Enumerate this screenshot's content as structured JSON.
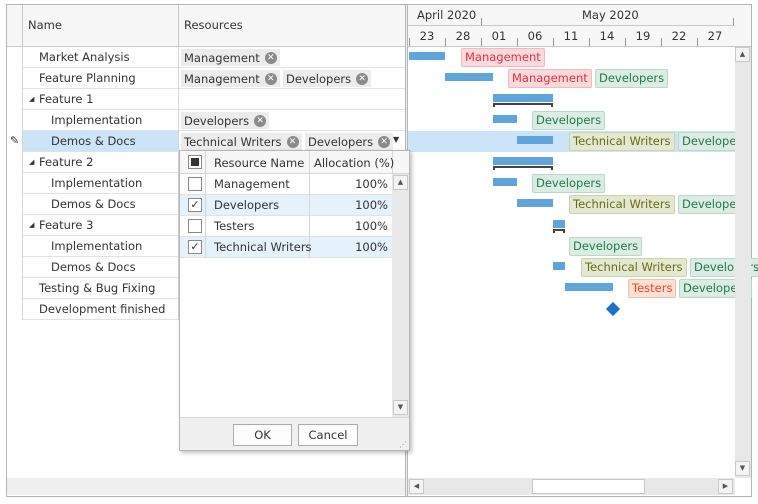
{
  "grid": {
    "columns": {
      "name": "Name",
      "resources": "Resources"
    },
    "rows": [
      {
        "name": "Market Analysis",
        "level": 0,
        "resources": [
          "Management"
        ]
      },
      {
        "name": "Feature Planning",
        "level": 0,
        "resources": [
          "Management",
          "Developers"
        ]
      },
      {
        "name": "Feature 1",
        "level": 0,
        "group": true,
        "resources": []
      },
      {
        "name": "Implementation",
        "level": 1,
        "resources": [
          "Developers"
        ]
      },
      {
        "name": "Demos & Docs",
        "level": 1,
        "selected": true,
        "editing": true,
        "resources": [
          "Technical Writers",
          "Developers"
        ]
      },
      {
        "name": "Feature 2",
        "level": 0,
        "group": true,
        "resources": []
      },
      {
        "name": "Implementation",
        "level": 1,
        "resources": []
      },
      {
        "name": "Demos & Docs",
        "level": 1,
        "resources": []
      },
      {
        "name": "Feature 3",
        "level": 0,
        "group": true,
        "resources": []
      },
      {
        "name": "Implementation",
        "level": 1,
        "resources": []
      },
      {
        "name": "Demos & Docs",
        "level": 1,
        "resources": []
      },
      {
        "name": "Testing & Bug Fixing",
        "level": 0,
        "resources": []
      },
      {
        "name": "Development finished",
        "level": 0,
        "resources": []
      }
    ]
  },
  "timescale": {
    "months": [
      "April 2020",
      "May 2020"
    ],
    "days": [
      "23",
      "28",
      "01",
      "06",
      "11",
      "14",
      "19",
      "22",
      "27"
    ]
  },
  "gantt_labels": [
    [
      "Management"
    ],
    [
      "Management",
      "Developers"
    ],
    [],
    [
      "Developers"
    ],
    [
      "Technical Writers",
      "Developers"
    ],
    [],
    [
      "Developers"
    ],
    [
      "Technical Writers",
      "Developers"
    ],
    [],
    [
      "Developers"
    ],
    [
      "Technical Writers",
      "Developers"
    ],
    [
      "Testers",
      "Developers"
    ],
    []
  ],
  "resource_colors": {
    "Management": {
      "bg": "#fbdadc",
      "border": "#f5b8bc",
      "text": "#e3313d"
    },
    "Developers": {
      "bg": "#dcebe3",
      "border": "#b9d9c7",
      "text": "#1f7a4b"
    },
    "Technical Writers": {
      "bg": "#e3e8d2",
      "border": "#cbd3ae",
      "text": "#6a6a12"
    },
    "Testers": {
      "bg": "#fde1d8",
      "border": "#f8bca9",
      "text": "#f2461a"
    }
  },
  "popup": {
    "columns": {
      "name": "Resource Name",
      "allocation": "Allocation (%)"
    },
    "items": [
      {
        "name": "Management",
        "allocation": "100%",
        "checked": false
      },
      {
        "name": "Developers",
        "allocation": "100%",
        "checked": true
      },
      {
        "name": "Testers",
        "allocation": "100%",
        "checked": false
      },
      {
        "name": "Technical Writers",
        "allocation": "100%",
        "checked": true
      }
    ],
    "ok": "OK",
    "cancel": "Cancel"
  }
}
